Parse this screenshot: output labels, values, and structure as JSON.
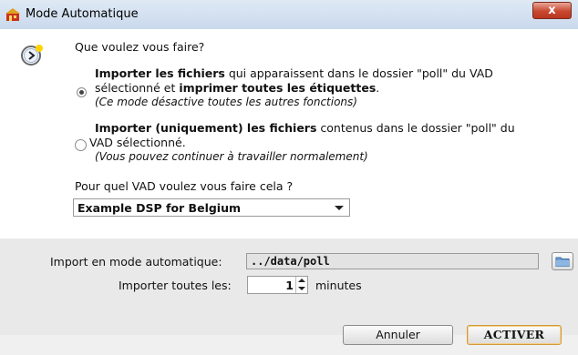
{
  "window": {
    "title": "Mode Automatique",
    "close_label": "x"
  },
  "dialog": {
    "question": "Que voulez vous faire?",
    "option1": {
      "line1_bold1": "Importer les fichiers",
      "line1_rest": " qui apparaissent dans le dossier \"poll\" du VAD",
      "line2_start": "sélectionné et ",
      "line2_bold": "imprimer toutes les étiquettes",
      "line2_end": ".",
      "note": "(Ce mode désactive toutes les autres fonctions)",
      "selected": true
    },
    "option2": {
      "line1_bold": "Importer (uniquement) les fichiers",
      "line1_rest": " contenus dans le dossier \"poll\" du",
      "line2": "VAD sélectionné.",
      "note": "(Vous pouvez continuer à travailler normalement)",
      "selected": false
    },
    "vad_question": "Pour quel VAD voulez vous faire cela ?",
    "vad_select_value": "Example DSP for Belgium"
  },
  "settings": {
    "path_label": "Import en mode automatique:",
    "path_value": "../data/poll",
    "interval_label": "Importer toutes les:",
    "interval_value": "1",
    "interval_unit": "minutes"
  },
  "buttons": {
    "cancel": "Annuler",
    "activate": "ACTIVER"
  },
  "colors": {
    "titlebar": "#c9d9ec",
    "close": "#c8482f",
    "activate_border": "#d29a3c"
  }
}
